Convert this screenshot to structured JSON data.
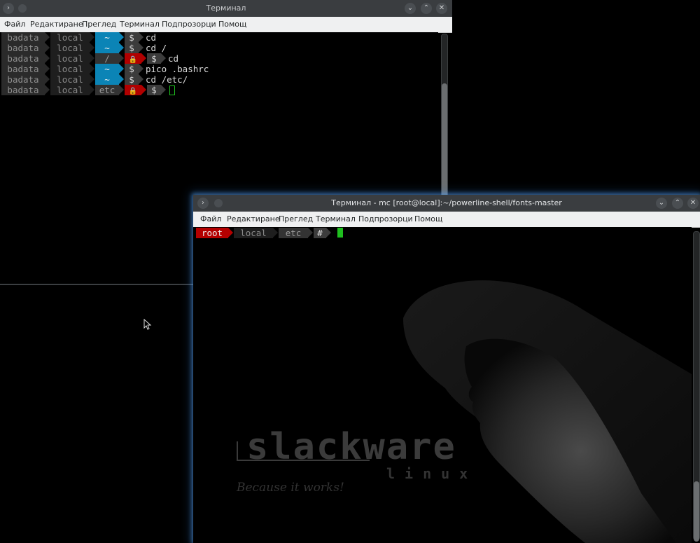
{
  "window1": {
    "title": "Терминал",
    "menu": [
      "Файл",
      "Редактиране",
      "Преглед",
      "Терминал",
      "Подпрозорци",
      "Помощ"
    ],
    "lines": [
      {
        "user": "badata",
        "host": "local",
        "path": "~",
        "path_style": "tilde",
        "lock": false,
        "prompt": "$",
        "command": "cd"
      },
      {
        "user": "badata",
        "host": "local",
        "path": "~",
        "path_style": "tilde",
        "lock": false,
        "prompt": "$",
        "command": "cd /"
      },
      {
        "user": "badata",
        "host": "local",
        "path": "/",
        "path_style": "path",
        "lock": true,
        "prompt": "$",
        "command": "cd"
      },
      {
        "user": "badata",
        "host": "local",
        "path": "~",
        "path_style": "tilde",
        "lock": false,
        "prompt": "$",
        "command": "pico .bashrc"
      },
      {
        "user": "badata",
        "host": "local",
        "path": "~",
        "path_style": "tilde",
        "lock": false,
        "prompt": "$",
        "command": "cd /etc/"
      },
      {
        "user": "badata",
        "host": "local",
        "path": "etc",
        "path_style": "path",
        "lock": true,
        "prompt": "$",
        "command": ""
      }
    ]
  },
  "window2": {
    "title": "Терминал - mc [root@local]:~/powerline-shell/fonts-master",
    "menu": [
      "Файл",
      "Редактиране",
      "Преглед",
      "Терминал",
      "Подпрозорци",
      "Помощ"
    ],
    "prompt": {
      "user": "root",
      "host": "local",
      "path": "etc",
      "symbol": "#"
    },
    "wallpaper": {
      "brand": "slackware",
      "sub": "linux",
      "tagline": "Because it works!"
    }
  },
  "colors": {
    "accent_blue": "#0b84b6",
    "lock_red": "#b10000",
    "cursor_green": "#1fbf1f",
    "glow": "#5aaaff"
  },
  "icons": {
    "lock": "padlock-icon",
    "window_menu": "chevron-right-icon",
    "minimize": "chevron-down-icon",
    "maximize": "chevron-up-icon",
    "close": "close-icon",
    "mouse_cursor": "pointer-arrow-icon"
  }
}
